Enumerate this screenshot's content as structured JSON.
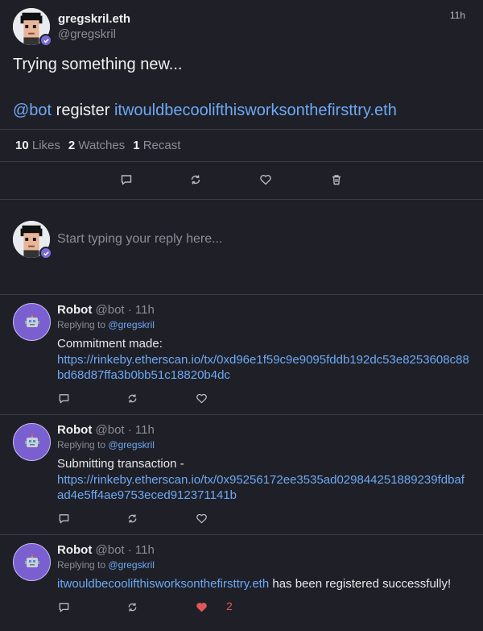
{
  "cast": {
    "display_name": "gregskril.eth",
    "handle": "@gregskril",
    "time": "11h",
    "text_line1": "Trying something new...",
    "mention": "@bot",
    "command": "register",
    "domain": "itwouldbecoolifthisworksonthefirsttry.eth"
  },
  "stats": {
    "likes_count": "10",
    "likes_label": "Likes",
    "watches_count": "2",
    "watches_label": "Watches",
    "recasts_count": "1",
    "recasts_label": "Recast"
  },
  "composer": {
    "placeholder": "Start typing your reply here..."
  },
  "replies": [
    {
      "name": "Robot",
      "meta": "@bot · 11h",
      "replying_prefix": "Replying to",
      "replying_to": "@gregskril",
      "text": "Commitment made:",
      "link": "https://rinkeby.etherscan.io/tx/0xd96e1f59c9e9095fddb192dc53e8253608c88bd68d87ffa3b0bb51c18820b4dc"
    },
    {
      "name": "Robot",
      "meta": "@bot · 11h",
      "replying_prefix": "Replying to",
      "replying_to": "@gregskril",
      "text": "Submitting transaction -",
      "link": "https://rinkeby.etherscan.io/tx/0x95256172ee3535ad029844251889239fdbafad4e5ff4ae9753eced912371141b"
    },
    {
      "name": "Robot",
      "meta": "@bot · 11h",
      "replying_prefix": "Replying to",
      "replying_to": "@gregskril",
      "link": "itwouldbecoolifthisworksonthefirsttry.eth",
      "text_after": "has been registered successfully!",
      "like_count": "2"
    }
  ],
  "colors": {
    "background": "#1f2027",
    "link": "#6ea8f5",
    "accent_purple": "#7a5fd0",
    "liked_red": "#e05656"
  }
}
